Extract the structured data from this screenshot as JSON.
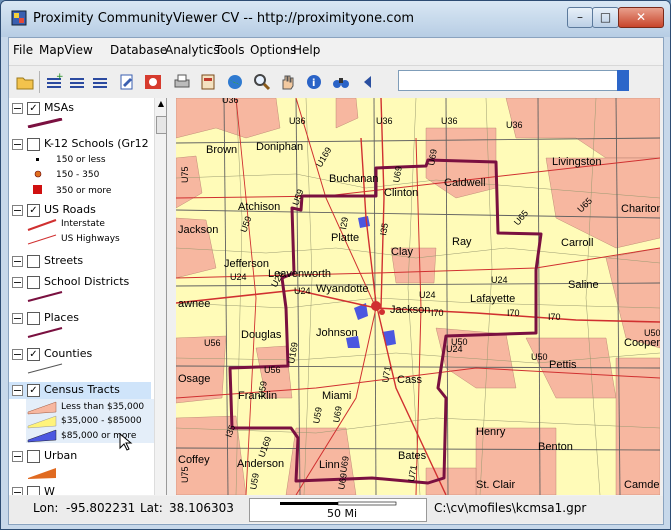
{
  "window": {
    "title": "Proximity CommunityViewer CV -- http://proximityone.com",
    "minimize": "–",
    "maximize": "□",
    "close": "✕"
  },
  "menu": [
    "File",
    "MapView",
    "Database",
    "Analytics",
    "Tools",
    "Options",
    "Help"
  ],
  "toolbar": {
    "icons": [
      "open-folder-icon",
      "add-layer-icon",
      "layer-list-icon",
      "edit-icon",
      "record-icon",
      "print-icon",
      "export-icon",
      "globe-icon",
      "zoom-icon",
      "pan-icon",
      "info-icon",
      "find-icon",
      "back-arrow-icon"
    ],
    "search_value": ""
  },
  "legend": {
    "layers": [
      {
        "name": "MSAs",
        "checked": true
      },
      {
        "name": "K-12 Schools (Gr12",
        "checked": false,
        "items": [
          "150 or less",
          "150 - 350",
          "350 or more"
        ]
      },
      {
        "name": "US Roads",
        "checked": true,
        "items": [
          "Interstate",
          "US Highways"
        ]
      },
      {
        "name": "Streets",
        "checked": false
      },
      {
        "name": "School Districts",
        "checked": false
      },
      {
        "name": "Places",
        "checked": false
      },
      {
        "name": "Counties",
        "checked": true
      },
      {
        "name": "Census Tracts",
        "checked": true,
        "items": [
          "Less than $35,000",
          "$35,000 - $85000",
          "$85,000 or more"
        ]
      },
      {
        "name": "Urban",
        "checked": false
      },
      {
        "name": "W",
        "checked": false
      }
    ],
    "colors": {
      "low": "#f7b7a0",
      "mid": "#fff9b0",
      "high": "#4b57e0",
      "msa": "#7a1040",
      "road": "#d03030"
    }
  },
  "map": {
    "county_labels": [
      "Doniphan",
      "Buchanan",
      "Clinton",
      "Caldwell",
      "Livingston",
      "Chariton",
      "Atchison",
      "Platte",
      "Clay",
      "Ray",
      "Carroll",
      "Saline",
      "Leavenworth",
      "Jefferson",
      "Wyandotte",
      "Jackson",
      "Lafayette",
      "Johnson",
      "Douglas",
      "Cass",
      "Pettis",
      "Franklin",
      "Miami",
      "Henry",
      "Benton",
      "Anderson",
      "Linn",
      "Bates",
      "St. Clair",
      "Coffey",
      "Osage",
      "Cooper",
      "Camden",
      "Brown",
      "Jackson",
      "awnee"
    ],
    "road_labels": [
      "U36",
      "U36",
      "U36",
      "U36",
      "U36",
      "U59",
      "U69",
      "U69",
      "U169",
      "U75",
      "U59",
      "I29",
      "I35",
      "U65",
      "U24",
      "U24",
      "U24",
      "U24",
      "I70",
      "I70",
      "I70",
      "U24",
      "U24",
      "U56",
      "U50",
      "U50",
      "U56",
      "U169",
      "U59",
      "U71",
      "U59",
      "U69",
      "I35",
      "U69",
      "U169",
      "U75",
      "U59",
      "U69",
      "U71",
      "U50",
      "U65"
    ]
  },
  "status": {
    "lon_label": "Lon:",
    "lon": "-95.802231",
    "lat_label": "Lat:",
    "lat": "38.106303",
    "scale": "50 Mi",
    "file": "C:\\cv\\mofiles\\kcmsa1.gpr"
  }
}
